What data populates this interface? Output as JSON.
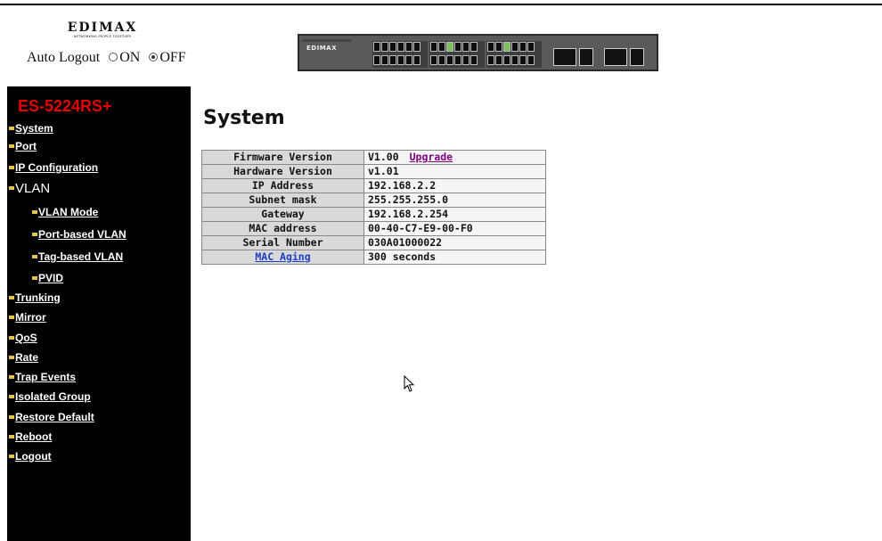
{
  "header": {
    "logo_text": "EDIMAX",
    "logo_tagline": "NETWORKING PEOPLE TOGETHER",
    "auto_logout_label": "Auto Logout",
    "on_label": "ON",
    "off_label": "OFF",
    "auto_logout_value": "OFF",
    "switch_brand": "EDIMAX"
  },
  "sidebar": {
    "title": "ES-5224RS+",
    "title_color": "#e60000",
    "items": [
      {
        "label": "System"
      },
      {
        "label": "Port"
      },
      {
        "label": "IP Configuration"
      },
      {
        "label": "VLAN"
      },
      {
        "label": "VLAN Mode"
      },
      {
        "label": "Port-based VLAN"
      },
      {
        "label": "Tag-based VLAN"
      },
      {
        "label": "PVID"
      },
      {
        "label": "Trunking"
      },
      {
        "label": "Mirror"
      },
      {
        "label": "QoS"
      },
      {
        "label": "Rate"
      },
      {
        "label": "Trap Events"
      },
      {
        "label": "Isolated Group"
      },
      {
        "label": "Restore Default"
      },
      {
        "label": "Reboot"
      },
      {
        "label": "Logout"
      }
    ]
  },
  "main": {
    "title": "System",
    "rows": [
      {
        "label": "Firmware Version",
        "value": "V1.00",
        "link": "Upgrade"
      },
      {
        "label": "Hardware Version",
        "value": "v1.01"
      },
      {
        "label": "IP Address",
        "value": "192.168.2.2"
      },
      {
        "label": "Subnet mask",
        "value": "255.255.255.0"
      },
      {
        "label": "Gateway",
        "value": "192.168.2.254"
      },
      {
        "label": "MAC address",
        "value": "00-40-C7-E9-00-F0"
      },
      {
        "label": "Serial Number",
        "value": "030A01000022"
      },
      {
        "label": "MAC Aging",
        "value": "300 seconds",
        "label_is_link": true
      }
    ]
  }
}
